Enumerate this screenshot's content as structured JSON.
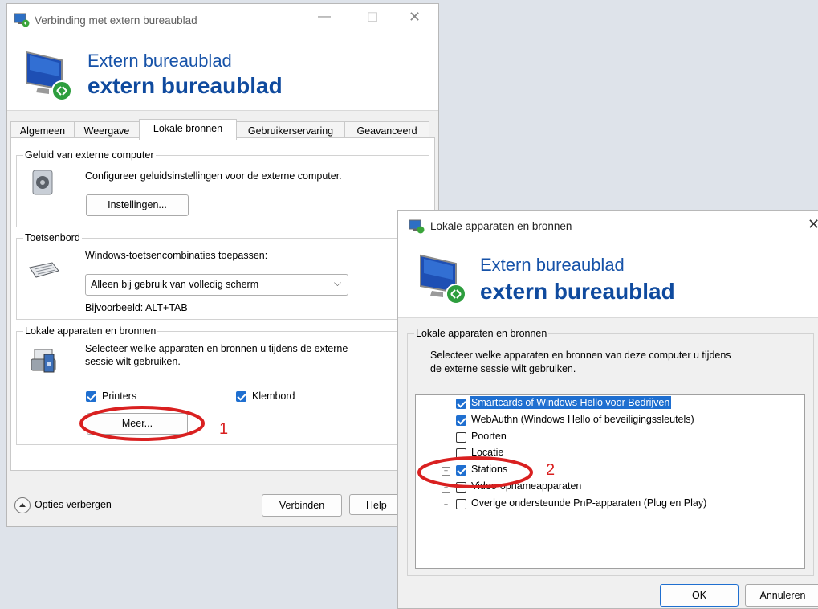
{
  "main_window": {
    "title": "Verbinding met extern bureaublad",
    "banner_line1": "Extern bureaublad",
    "banner_line2": "extern bureaublad",
    "tabs": [
      "Algemeen",
      "Weergave",
      "Lokale bronnen",
      "Gebruikerservaring",
      "Geavanceerd"
    ],
    "active_tab": "Lokale bronnen",
    "audio": {
      "group_label": "Geluid van externe computer",
      "description": "Configureer geluidsinstellingen voor de externe computer.",
      "button": "Instellingen..."
    },
    "keyboard": {
      "group_label": "Toetsenbord",
      "description": "Windows-toetsencombinaties toepassen:",
      "dropdown_value": "Alleen bij gebruik van volledig scherm",
      "example": "Bijvoorbeeld: ALT+TAB"
    },
    "local_devices": {
      "group_label": "Lokale apparaten en bronnen",
      "description_line1": "Selecteer welke apparaten en bronnen u tijdens de externe",
      "description_line2": "sessie wilt gebruiken.",
      "printers_label": "Printers",
      "printers_checked": true,
      "clipboard_label": "Klembord",
      "clipboard_checked": true,
      "more_button": "Meer..."
    },
    "options_toggle": "Opties verbergen",
    "connect_button": "Verbinden",
    "help_button": "Help"
  },
  "dialog": {
    "title": "Lokale apparaten en bronnen",
    "banner_line1": "Extern bureaublad",
    "banner_line2": "extern bureaublad",
    "group_label": "Lokale apparaten en bronnen",
    "description_line1": "Selecteer welke apparaten en bronnen van deze computer u tijdens",
    "description_line2": "de externe sessie wilt gebruiken.",
    "items": [
      {
        "label": "Smartcards of Windows Hello voor Bedrijven",
        "checked": true,
        "expandable": false,
        "selected": true
      },
      {
        "label": "WebAuthn (Windows Hello of beveiligingssleutels)",
        "checked": true,
        "expandable": false,
        "selected": false
      },
      {
        "label": "Poorten",
        "checked": false,
        "expandable": false,
        "selected": false
      },
      {
        "label": "Locatie",
        "checked": false,
        "expandable": false,
        "selected": false
      },
      {
        "label": "Stations",
        "checked": true,
        "expandable": true,
        "selected": false
      },
      {
        "label": "Video-opnameapparaten",
        "checked": false,
        "expandable": true,
        "selected": false
      },
      {
        "label": "Overige ondersteunde PnP-apparaten (Plug en Play)",
        "checked": false,
        "expandable": true,
        "selected": false
      }
    ],
    "ok_button": "OK",
    "cancel_button": "Annuleren"
  },
  "annotations": {
    "step1": "1",
    "step2": "2",
    "color": "#d92020"
  }
}
